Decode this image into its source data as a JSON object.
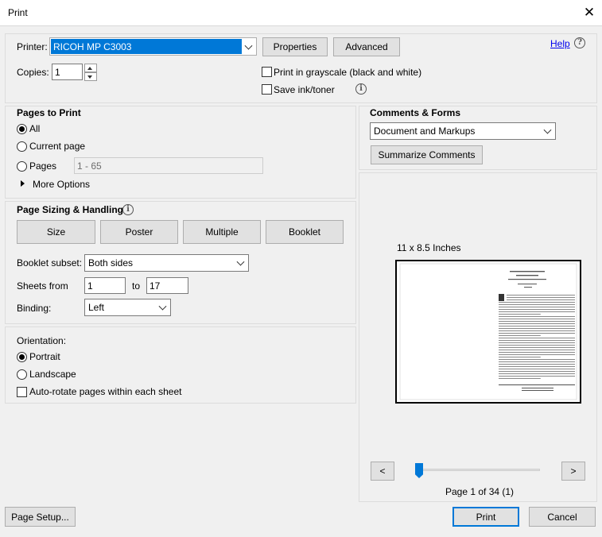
{
  "window": {
    "title": "Print",
    "close_glyph": "✕"
  },
  "printer": {
    "label": "Printer:",
    "selected": "RICOH MP C3003",
    "properties_label": "Properties",
    "advanced_label": "Advanced",
    "help_label": "Help",
    "copies_label": "Copies:",
    "copies_value": "1",
    "grayscale_label": "Print in grayscale (black and white)",
    "save_ink_label": "Save ink/toner"
  },
  "pages_to_print": {
    "title": "Pages to Print",
    "all_label": "All",
    "current_page_label": "Current page",
    "pages_label": "Pages",
    "pages_value": "1 - 65",
    "more_options_label": "More Options"
  },
  "sizing": {
    "title": "Page Sizing & Handling",
    "size_label": "Size",
    "poster_label": "Poster",
    "multiple_label": "Multiple",
    "booklet_label": "Booklet",
    "booklet_subset_label": "Booklet subset:",
    "booklet_subset_value": "Both sides",
    "sheets_from_label": "Sheets from",
    "sheets_from_value": "1",
    "sheets_to_label": "to",
    "sheets_to_value": "17",
    "binding_label": "Binding:",
    "binding_value": "Left"
  },
  "orientation": {
    "title": "Orientation:",
    "portrait_label": "Portrait",
    "landscape_label": "Landscape",
    "autorotate_label": "Auto-rotate pages within each sheet"
  },
  "comments": {
    "title": "Comments & Forms",
    "selected": "Document and Markups",
    "summarize_label": "Summarize Comments"
  },
  "preview": {
    "size_label": "11 x 8.5 Inches",
    "prev_label": "<",
    "next_label": ">",
    "page_info": "Page 1 of 34 (1)"
  },
  "footer": {
    "page_setup_label": "Page Setup...",
    "print_label": "Print",
    "cancel_label": "Cancel"
  },
  "colors": {
    "accent": "#0078d7",
    "selection": "#0078d7",
    "link": "#0000ee"
  }
}
